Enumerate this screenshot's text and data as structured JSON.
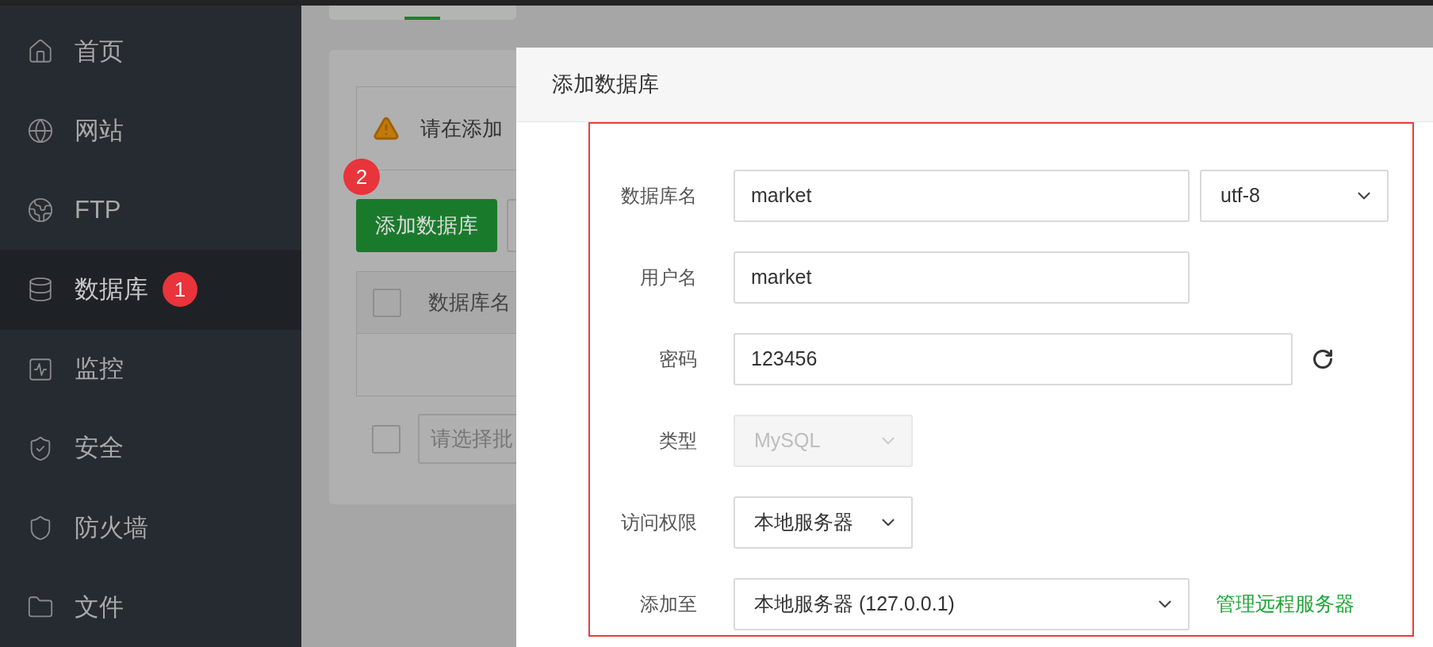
{
  "sidebar": {
    "items": [
      {
        "label": "首页",
        "selected": false
      },
      {
        "label": "网站",
        "selected": false
      },
      {
        "label": "FTP",
        "selected": false
      },
      {
        "label": "数据库",
        "selected": true,
        "badge": "1"
      },
      {
        "label": "监控",
        "selected": false
      },
      {
        "label": "安全",
        "selected": false
      },
      {
        "label": "防火墙",
        "selected": false
      },
      {
        "label": "文件",
        "selected": false
      }
    ]
  },
  "page": {
    "notice": "请在添加",
    "step_badge": "2",
    "add_button": "添加数据库",
    "table": {
      "columns": [
        "数据库名"
      ],
      "select_all_checked": false
    },
    "batch": {
      "checked": false,
      "placeholder": "请选择批"
    }
  },
  "dialog": {
    "title": "添加数据库",
    "fields": [
      {
        "kind": "input",
        "label": "数据库名",
        "value": "market",
        "extra": {
          "kind": "select",
          "value": "utf-8"
        }
      },
      {
        "kind": "input",
        "label": "用户名",
        "value": "market"
      },
      {
        "kind": "input",
        "label": "密码",
        "value": "123456",
        "refresh": true
      },
      {
        "kind": "select",
        "label": "类型",
        "value": "MySQL",
        "disabled": true
      },
      {
        "kind": "select",
        "label": "访问权限",
        "value": "本地服务器",
        "disabled": false
      },
      {
        "kind": "select",
        "label": "添加至",
        "value": "本地服务器 (127.0.0.1)",
        "disabled": false,
        "wide": true,
        "link": "管理远程服务器"
      }
    ]
  }
}
